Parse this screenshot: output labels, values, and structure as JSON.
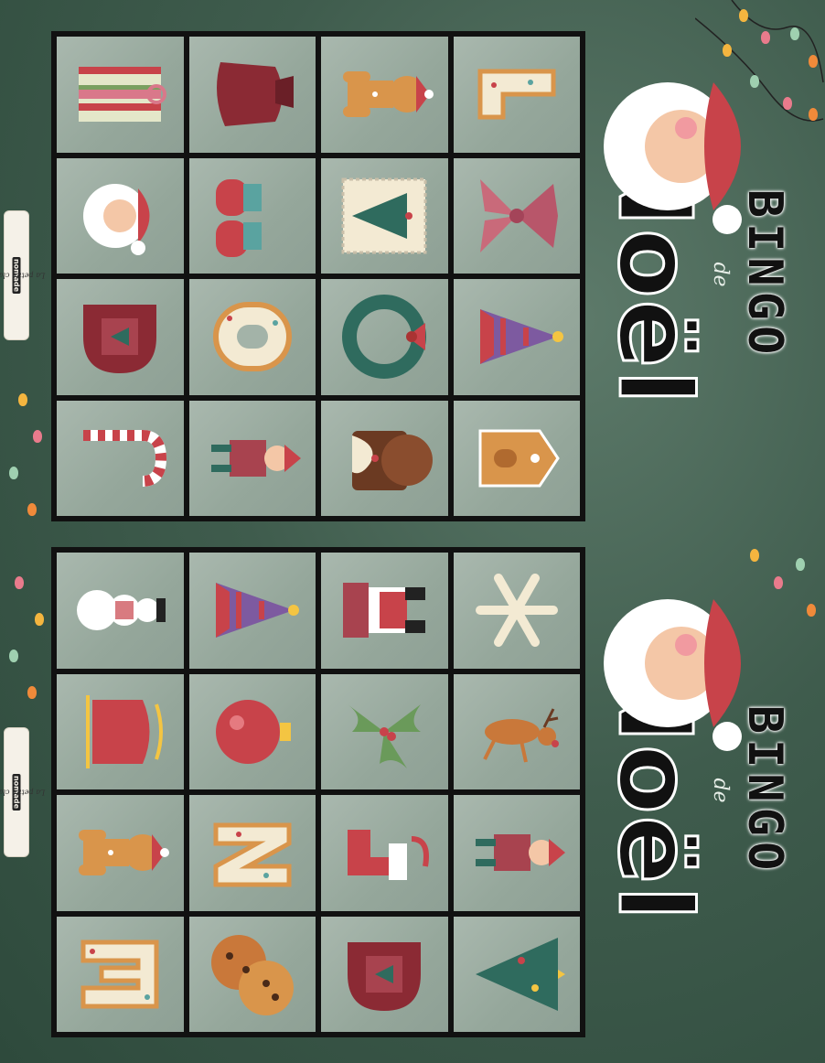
{
  "brand_tag": {
    "text": "La petite classe ",
    "highlight": "nomade"
  },
  "cards": [
    {
      "title_line1": "BINGO",
      "title_line2": "de",
      "title_line3": "Noël",
      "cells": [
        [
          "gift-icon",
          "sack-icon",
          "gingerbread-man-icon",
          "letter-l-cookie-icon"
        ],
        [
          "santa-head-icon",
          "mittens-icon",
          "christmas-stamp-icon",
          "bow-icon"
        ],
        [
          "letter-d-cookie-icon",
          "letter-o-cookie-icon",
          "wreath-icon",
          "elf-hat-icon"
        ],
        [
          "candy-cane-icon",
          "elf-icon",
          "yule-log-icon",
          "gingerbread-house-icon"
        ]
      ]
    },
    {
      "title_line1": "BINGO",
      "title_line2": "de",
      "title_line3": "Noël",
      "cells": [
        [
          "snowman-icon",
          "elf-hat-icon",
          "santa-chimney-icon",
          "snowflake-icon"
        ],
        [
          "sleigh-icon",
          "ornament-icon",
          "holly-icon",
          "reindeer-icon"
        ],
        [
          "gingerbread-man-icon",
          "letter-n-cookie-icon",
          "stocking-icon",
          "elf-icon"
        ],
        [
          "letter-e-cookie-icon",
          "cookies-icon",
          "letter-d-cookie-icon",
          "christmas-tree-icon"
        ]
      ]
    }
  ],
  "colors": {
    "background": "#3f5c4d",
    "cell": "#a3b3a8",
    "grid_border": "#111111",
    "red": "#c8434a",
    "cookie": "#d9954b"
  }
}
